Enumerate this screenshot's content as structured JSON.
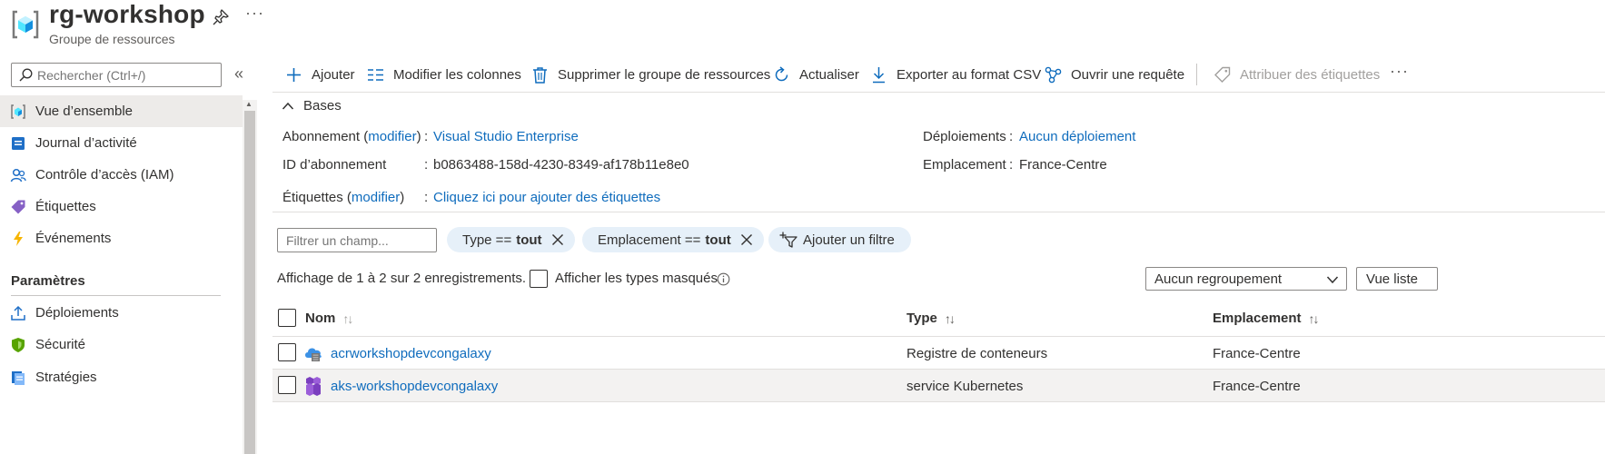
{
  "header": {
    "title": "rg-workshop",
    "subtitle": "Groupe de ressources",
    "more": "···"
  },
  "sidebar": {
    "search_placeholder": "Rechercher (Ctrl+/)",
    "collapse": "«",
    "items": [
      {
        "label": "Vue d’ensemble",
        "icon": "resource-group-icon"
      },
      {
        "label": "Journal d’activité",
        "icon": "activity-log-icon"
      },
      {
        "label": "Contrôle d’accès (IAM)",
        "icon": "iam-icon"
      },
      {
        "label": "Étiquettes",
        "icon": "tag-icon"
      },
      {
        "label": "Événements",
        "icon": "lightning-icon"
      }
    ],
    "section_title": "Paramètres",
    "settings_items": [
      {
        "label": "Déploiements",
        "icon": "deploy-icon"
      },
      {
        "label": "Sécurité",
        "icon": "shield-icon"
      },
      {
        "label": "Stratégies",
        "icon": "policy-icon"
      }
    ]
  },
  "toolbar": {
    "add": "Ajouter",
    "edit_columns": "Modifier les colonnes",
    "delete_group": "Supprimer le groupe de ressources",
    "refresh": "Actualiser",
    "export_csv": "Exporter au format CSV",
    "open_query": "Ouvrir une requête",
    "assign_tags": "Attribuer des étiquettes",
    "more": "···"
  },
  "essentials": {
    "heading": "Bases",
    "subscription_label": "Abonnement",
    "modify": "modifier",
    "colon": ":",
    "subscription_value": "Visual Studio Enterprise",
    "subscription_id_label": "ID d’abonnement",
    "subscription_id_value": "b0863488-158d-4230-8349-af178b11e8e0",
    "tags_label": "Étiquettes",
    "tags_value": "Cliquez ici pour ajouter des étiquettes",
    "deployments_label": "Déploiements",
    "deployments_value": "Aucun déploiement",
    "location_label": "Emplacement",
    "location_value": "France-Centre"
  },
  "filters": {
    "field_placeholder": "Filtrer un champ...",
    "type_prefix": "Type ==",
    "type_value": "tout",
    "location_prefix": "Emplacement ==",
    "location_value": "tout",
    "add_filter": "Ajouter un filtre"
  },
  "records": {
    "summary": "Affichage de 1 à 2 sur 2 enregistrements.",
    "show_hidden": "Afficher les types masqués",
    "grouping": "Aucun regroupement",
    "view": "Vue liste"
  },
  "table": {
    "columns": {
      "name": "Nom",
      "type": "Type",
      "location": "Emplacement"
    },
    "sort_glyph": "↑↓",
    "rows": [
      {
        "name": "acrworkshopdevcongalaxy",
        "type": "Registre de conteneurs",
        "location": "France-Centre",
        "icon": "container-registry-icon"
      },
      {
        "name": "aks-workshopdevcongalaxy",
        "type": "service Kubernetes",
        "location": "France-Centre",
        "icon": "kubernetes-icon"
      }
    ]
  },
  "colors": {
    "accent": "#0f6cbd",
    "pill_bg": "#e6f0f9",
    "selected_bg": "#edebe9"
  }
}
